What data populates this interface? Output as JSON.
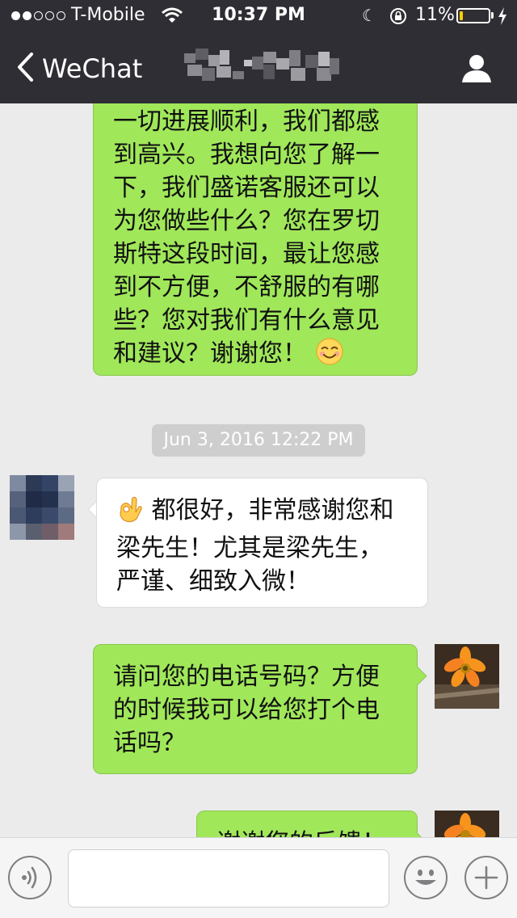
{
  "status_bar": {
    "carrier": "T-Mobile",
    "time": "10:37 PM",
    "battery_percent": "11%",
    "battery_level": 0.11,
    "battery_color": "#ffcc00",
    "icons": [
      "signal-dots-icon",
      "wifi-icon",
      "moon-icon",
      "rotation-lock-icon",
      "battery-icon",
      "charging-bolt-icon"
    ]
  },
  "nav": {
    "back_label": "WeChat",
    "title": "",
    "icons": [
      "chevron-left-icon",
      "contact-profile-icon"
    ]
  },
  "messages": [
    {
      "sender": "me",
      "lines": [
        "一切进展顺利，我们都感",
        "到高兴。我想向您了解一",
        "下，我们盛诺客服还可以",
        "为您做些什么？您在罗切",
        "斯特这段时间，最让您感",
        "到不方便，不舒服的有哪",
        "些？您对我们有什么意见",
        "和建议？谢谢您！"
      ],
      "trailing_emoji": "smiling-face-emoji"
    },
    {
      "timestamp": "Jun 3, 2016 12:22 PM"
    },
    {
      "sender": "other",
      "leading_emoji": "ok-hand-emoji",
      "lines": [
        "都很好，非常感谢您和",
        "梁先生！尤其是梁先生，",
        "严谨、细致入微！"
      ]
    },
    {
      "sender": "me",
      "lines": [
        "请问您的电话号码？方便",
        "的时候我可以给您打个电",
        "话吗？"
      ]
    },
    {
      "sender": "me",
      "lines": [
        "谢谢您的反馈！"
      ]
    }
  ],
  "colors": {
    "nav_background": "#2e2e34",
    "chat_background": "#ebebeb",
    "my_bubble": "#a0e75a",
    "their_bubble": "#ffffff",
    "timestamp_pill": "#cececf"
  },
  "input_bar": {
    "placeholder": "",
    "icons": [
      "voice-input-icon",
      "emoji-face-icon",
      "plus-icon"
    ]
  }
}
